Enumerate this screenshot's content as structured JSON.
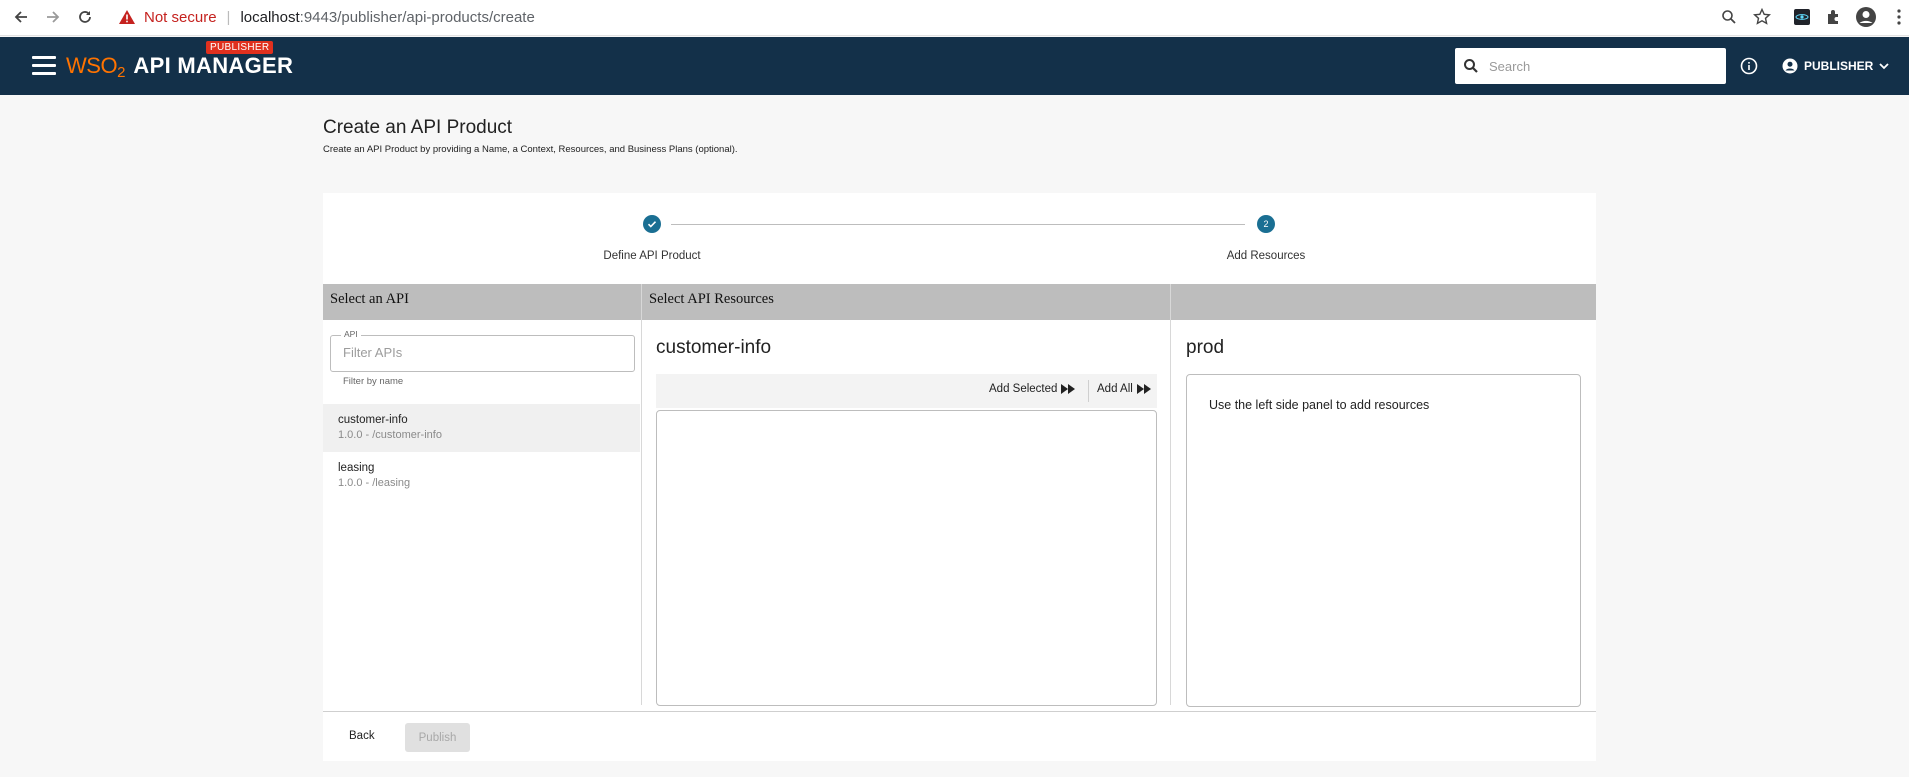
{
  "browser": {
    "not_secure": "Not secure",
    "url_host": "localhost",
    "url_path": ":9443/publisher/api-products/create"
  },
  "header": {
    "logo_wso": "WSO",
    "logo_2": "2",
    "logo_product": "API MANAGER",
    "badge": "PUBLISHER",
    "search_placeholder": "Search",
    "user_label": "PUBLISHER"
  },
  "page": {
    "title": "Create an API Product",
    "subtitle": "Create an API Product by providing a Name, a Context, Resources, and Business Plans (optional)."
  },
  "stepper": {
    "steps": [
      {
        "label": "Define API Product",
        "state": "completed"
      },
      {
        "label": "Add Resources",
        "number": "2",
        "state": "active"
      }
    ]
  },
  "columns": {
    "left_header": "Select an API",
    "middle_header": "Select API Resources",
    "right_header": ""
  },
  "filter": {
    "legend": "API",
    "placeholder": "Filter APIs",
    "helper": "Filter by name"
  },
  "apis": [
    {
      "name": "customer-info",
      "detail": "1.0.0 - /customer-info",
      "selected": true
    },
    {
      "name": "leasing",
      "detail": "1.0.0 - /leasing",
      "selected": false
    }
  ],
  "resources": {
    "title": "customer-info",
    "add_selected": "Add Selected",
    "add_all": "Add All"
  },
  "product": {
    "title": "prod",
    "empty_message": "Use the left side panel to add resources"
  },
  "footer": {
    "back": "Back",
    "publish": "Publish"
  },
  "colors": {
    "appbar": "#133049",
    "accent": "#1a6f93",
    "brand_orange": "#ff7300",
    "badge_red": "#e0301e"
  }
}
